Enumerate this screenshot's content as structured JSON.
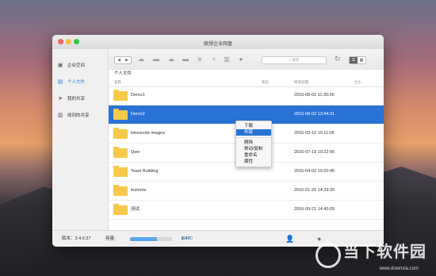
{
  "window": {
    "title": "联想企业网盘"
  },
  "sidebar": {
    "items": [
      {
        "label": "企业空间",
        "icon": "briefcase-icon",
        "selected": false
      },
      {
        "label": "个人文件",
        "icon": "folder-person-icon",
        "selected": true
      },
      {
        "label": "我的共享",
        "icon": "share-send-icon",
        "selected": false
      },
      {
        "label": "收到的共享",
        "icon": "share-receive-icon",
        "selected": false
      }
    ]
  },
  "toolbar": {
    "back": "◀",
    "forward": "▶",
    "search_placeholder": "搜索",
    "icons": [
      "upload-cloud-icon",
      "folder-upload-icon",
      "download-cloud-icon",
      "folder-link-icon",
      "camera-icon",
      "share-icon",
      "trash-icon",
      "settings-icon"
    ],
    "refresh": "↻",
    "view_list": "☰",
    "view_grid": "▦"
  },
  "breadcrumb": {
    "current": "个人文件"
  },
  "columns": {
    "name": "名称",
    "status": "状态",
    "modified": "修改日期",
    "size": "大小"
  },
  "files": [
    {
      "name": "Demo1",
      "date": "2016-08-02 11:30:06",
      "selected": false
    },
    {
      "name": "Demo2",
      "date": "2016-08-02 13:44:31",
      "selected": true
    },
    {
      "name": "leboxnote images",
      "date": "2016-03-10 15:11:05",
      "selected": false
    },
    {
      "name": "Qwe",
      "date": "2016-07-19 19:22:56",
      "selected": false
    },
    {
      "name": "Team Building",
      "date": "2015-04-02 10:20:45",
      "selected": false
    },
    {
      "name": "testnote",
      "date": "2016-01-26 14:39:20",
      "selected": false
    },
    {
      "name": "测试",
      "date": "2016-09-21 14:40:09",
      "selected": false
    }
  ],
  "context_menu": {
    "items": [
      "下载",
      "外链",
      "删除",
      "移动/复制",
      "重命名",
      "属性"
    ],
    "highlighted": "外链"
  },
  "status_bar": {
    "version_label": "版本：3.4.0.37",
    "capacity_label": "容量:",
    "used": "6.47 GB",
    "total": "10.00 GB",
    "separator": "/",
    "used_fraction": 0.647
  },
  "watermark": {
    "brand": "当下软件园",
    "url": "www.downxia.com"
  },
  "colors": {
    "accent": "#2a73d6",
    "folder": "#f7c94a",
    "progress": "#5ba7ec"
  }
}
